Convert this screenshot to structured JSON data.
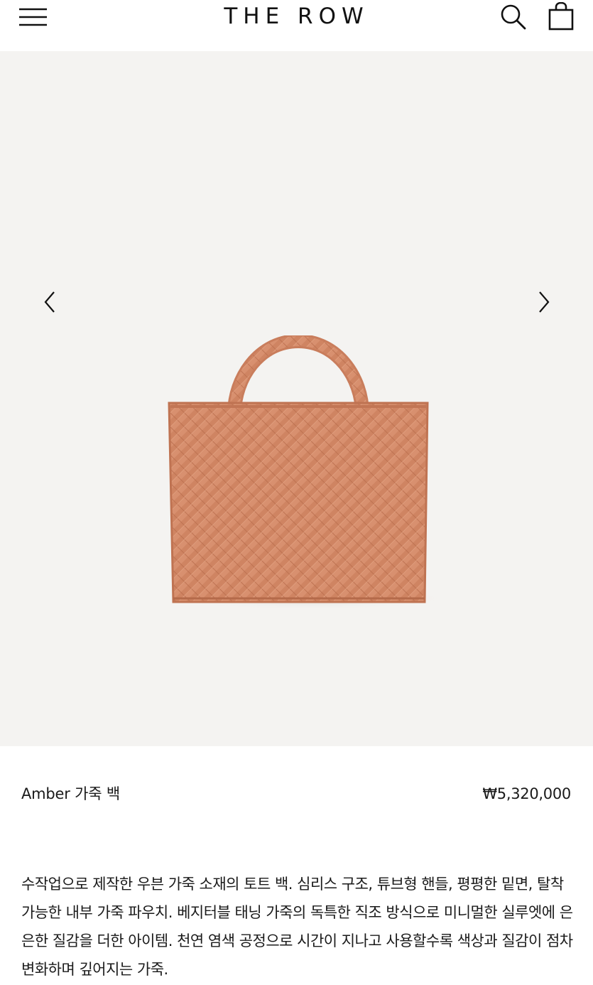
{
  "header": {
    "brand": "THE ROW",
    "icons": {
      "menu": "hamburger-menu-icon",
      "search": "search-icon",
      "bag": "shopping-bag-icon"
    }
  },
  "gallery": {
    "prev_icon": "chevron-left-icon",
    "next_icon": "chevron-right-icon",
    "background": "#f4f3f1",
    "product_color": "#d4896a"
  },
  "product": {
    "name": "Amber 가죽 백",
    "price": "₩5,320,000",
    "description": "수작업으로 제작한 우븐 가죽 소재의 토트 백. 심리스 구조, 튜브형 핸들, 평평한 밑면, 탈착 가능한 내부 가죽 파우치. 베지터블 태닝 가죽의 독특한 직조 방식으로 미니멀한 실루엣에 은은한 질감을 더한 아이템. 천연 염색 공정으로 시간이 지나고 사용할수록 색상과 질감이 점차 변화하며 깊어지는 가죽."
  }
}
